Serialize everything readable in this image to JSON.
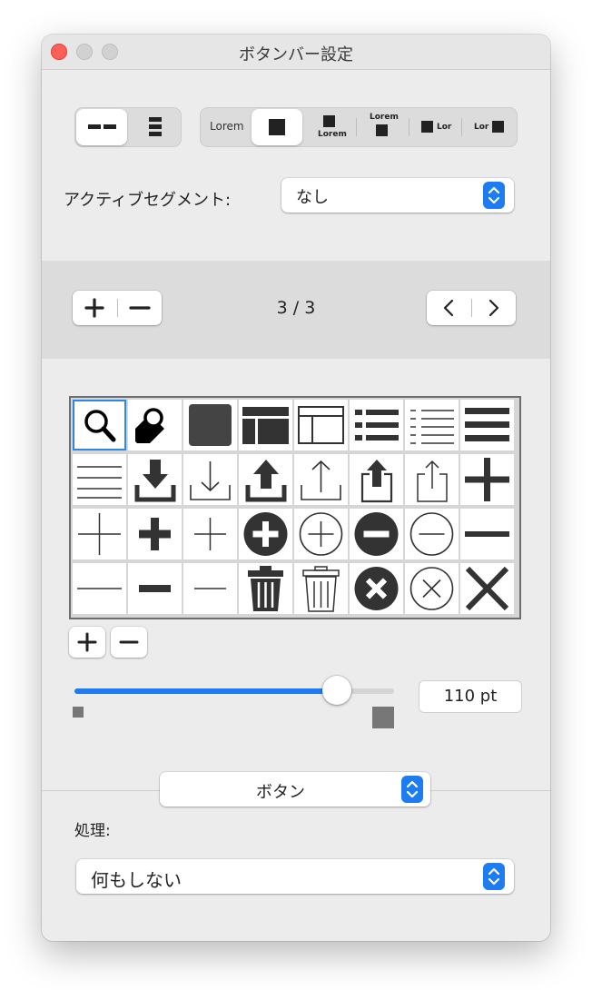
{
  "window": {
    "title": "ボタンバー設定"
  },
  "segment_controls": {
    "style_labels": [
      "Lorem",
      "Lorem",
      "Lorem",
      "Lor",
      "Lor"
    ]
  },
  "active_segment": {
    "label": "アクティブセグメント:",
    "value": "なし"
  },
  "pager": {
    "text": "3 / 3"
  },
  "icons": [
    "search-icon",
    "tag-icon",
    "filled-square-icon",
    "layout-icon",
    "window-layout-icon",
    "list-icon",
    "list-light-icon",
    "menu-icon",
    "lines-icon",
    "download-icon",
    "download-light-icon",
    "upload-icon",
    "upload-light-icon",
    "share-icon",
    "share-light-icon",
    "plus-bold-icon",
    "plus-thin-icon",
    "plus-icon",
    "plus-light-icon",
    "add-circle-icon",
    "add-circle-outline-icon",
    "remove-circle-icon",
    "remove-circle-outline-icon",
    "minus-bold-icon",
    "minus-thin-icon",
    "minus-icon",
    "minus-light-icon",
    "trash-icon",
    "trash-outline-icon",
    "close-circle-icon",
    "close-circle-outline-icon",
    "close-icon"
  ],
  "size": {
    "value": "110 pt",
    "fraction": 0.82
  },
  "mode": {
    "value": "ボタン"
  },
  "action": {
    "label": "処理:",
    "value": "何もしない"
  },
  "colors": {
    "accent": "#1d7cf2",
    "close": "#fe5f57"
  }
}
